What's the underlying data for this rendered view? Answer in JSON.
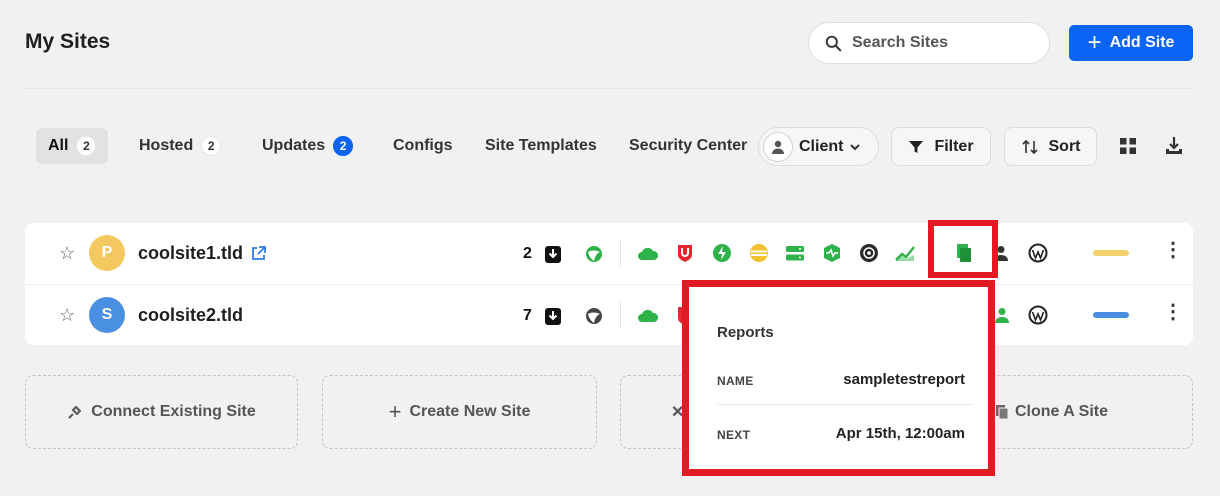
{
  "header": {
    "title": "My Sites",
    "search_placeholder": "Search Sites",
    "add_site_label": "Add Site"
  },
  "tabs": [
    {
      "label": "All",
      "count": "2"
    },
    {
      "label": "Hosted",
      "count": "2"
    },
    {
      "label": "Updates",
      "count": "2"
    },
    {
      "label": "Configs"
    },
    {
      "label": "Site Templates"
    },
    {
      "label": "Security Center"
    }
  ],
  "toolbar": {
    "client_label": "Client",
    "filter_label": "Filter",
    "sort_label": "Sort"
  },
  "sites": [
    {
      "initial": "P",
      "name": "coolsite1.tld",
      "updates": "2",
      "avatar_color": "#f3c85f",
      "tag_color": "#f3d06b"
    },
    {
      "initial": "S",
      "name": "coolsite2.tld",
      "updates": "7",
      "avatar_color": "#4a90e2",
      "tag_color": "#4a90e2"
    }
  ],
  "reports_tooltip": {
    "title": "Reports",
    "name_label": "NAME",
    "name_value": "sampletestreport",
    "next_label": "NEXT",
    "next_value": "Apr 15th, 12:00am"
  },
  "actions": {
    "connect_label": "Connect Existing Site",
    "create_label": "Create New Site",
    "clone_label": "Clone A Site"
  },
  "colors": {
    "accent": "#0b63f3",
    "highlight": "#e11b22",
    "green": "#2db34a",
    "red": "#e8262f",
    "yellow": "#f2c12e"
  }
}
